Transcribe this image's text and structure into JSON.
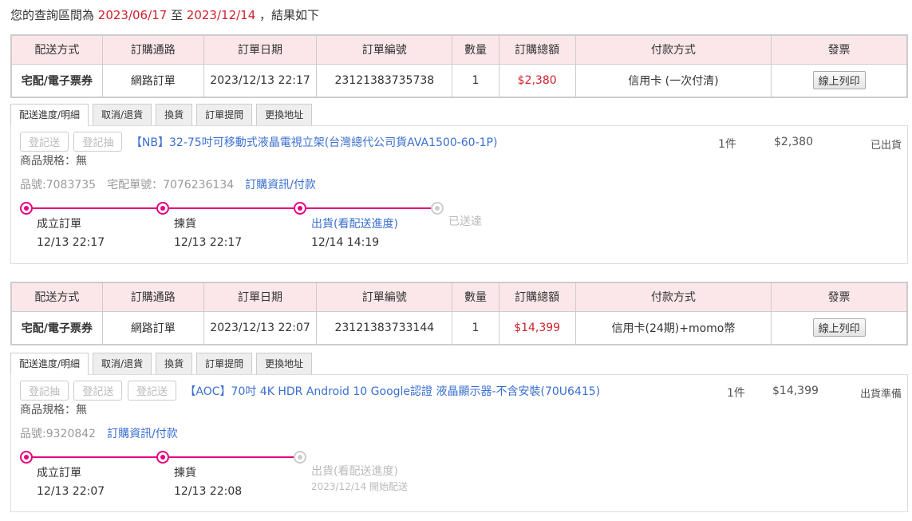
{
  "query_range": {
    "prefix": "您的查詢區間為 ",
    "start": "2023/06/17",
    "middle": " 至 ",
    "end": "2023/12/14",
    "suffix": " ，結果如下"
  },
  "headers": [
    "配送方式",
    "訂購通路",
    "訂單日期",
    "訂單編號",
    "數量",
    "訂購總額",
    "付款方式",
    "發票"
  ],
  "tabs": [
    "配送進度/明細",
    "取消/退貨",
    "換貨",
    "訂單提問",
    "更換地址"
  ],
  "orders": [
    {
      "ship_method": "宅配/電子票券",
      "channel": "網路訂單",
      "order_date": "2023/12/13 22:17",
      "order_no": "23121383735738",
      "quantity": "1",
      "total": "$2,380",
      "payment": "信用卡 (一次付清)",
      "invoice_button": "線上列印",
      "detail": {
        "buttons": [
          "登記送",
          "登記抽"
        ],
        "product_name": "【NB】32-75吋可移動式液晶電視立架(台灣總代公司貨AVA1500-60-1P)",
        "qty": "1件",
        "amount": "$2,380",
        "status": "已出貨",
        "spec": "商品規格：無",
        "item_no": "品號:7083735",
        "tracking": "宅配單號：7076236134",
        "info_link": "訂購資訊/付款",
        "timeline": [
          {
            "label": "成立訂單",
            "time": "12/13 22:17",
            "state": "done"
          },
          {
            "label": "揀貨",
            "time": "12/13 22:17",
            "state": "done"
          },
          {
            "label": "出貨(看配送進度)",
            "time": "12/14 14:19",
            "state": "done"
          },
          {
            "label": "已送達",
            "time": "",
            "state": "pending"
          }
        ]
      }
    },
    {
      "ship_method": "宅配/電子票券",
      "channel": "網路訂單",
      "order_date": "2023/12/13 22:07",
      "order_no": "23121383733144",
      "quantity": "1",
      "total": "$14,399",
      "payment": "信用卡(24期)+momo幣",
      "invoice_button": "線上列印",
      "detail": {
        "buttons": [
          "登記抽",
          "登記送",
          "登記送"
        ],
        "product_name": "【AOC】70吋 4K HDR Android 10 Google認證 液晶顯示器-不含安裝(70U6415)",
        "qty": "1件",
        "amount": "$14,399",
        "status": "出貨準備",
        "spec": "商品規格：無",
        "item_no": "品號:9320842",
        "info_link": "訂購資訊/付款",
        "timeline": [
          {
            "label": "成立訂單",
            "time": "12/13 22:07",
            "state": "done"
          },
          {
            "label": "揀貨",
            "time": "12/13 22:08",
            "state": "done"
          },
          {
            "label": "出貨(看配送進度)",
            "time": "2023/12/14 開始配送",
            "state": "pending"
          }
        ]
      }
    }
  ],
  "colors": {
    "accent_red": "#d0212b",
    "timeline_magenta": "#e6007e",
    "link_blue": "#3a6fd0",
    "header_pink": "#fbe7ea"
  }
}
